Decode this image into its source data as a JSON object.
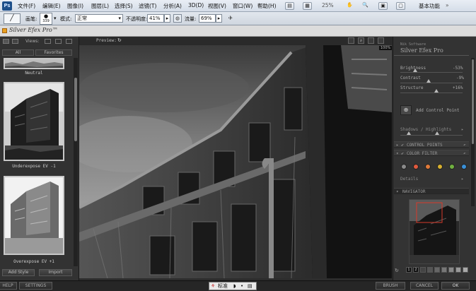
{
  "menubar": {
    "logo": "Ps",
    "items": [
      "文件(F)",
      "编辑(E)",
      "图像(I)",
      "图层(L)",
      "选择(S)",
      "滤镜(T)",
      "分析(A)",
      "3D(D)",
      "视图(V)",
      "窗口(W)",
      "帮助(H)"
    ],
    "zoom": "25%",
    "workspace": "基本功能"
  },
  "optionsbar": {
    "brush_label": "画笔:",
    "brush_size": "339",
    "mode_label": "模式:",
    "mode_value": "正常",
    "opacity_label": "不透明度:",
    "opacity_value": "41%",
    "flow_label": "流量:",
    "flow_value": "69%"
  },
  "plugin": {
    "title": "Silver Efex Pro™",
    "views_label": "Views:",
    "preview_label": "Preview:",
    "zoom": "100%"
  },
  "leftpanel": {
    "tabs": [
      "All",
      "Favorites"
    ],
    "presets": [
      "Neutral",
      "Underexpose EV -1",
      "Overexpose EV +1"
    ],
    "add_style": "Add Style",
    "import": "Import"
  },
  "rightpanel": {
    "brand": "Nik Software",
    "product": "Silver Efex Pro",
    "sliders": [
      {
        "label": "Brightness",
        "value": "-53%",
        "level": -0.53
      },
      {
        "label": "Contrast",
        "value": "-9%",
        "level": -0.09
      },
      {
        "label": "Structure",
        "value": "+16%",
        "level": 0.16
      }
    ],
    "add_control_point": "Add Control Point",
    "shadows_highlights": "Shadows / Highlights",
    "sections": [
      "CONTROL POINTS",
      "COLOR FILTER"
    ],
    "details": "Details",
    "navigator": "NAVIGATOR",
    "filter_colors": [
      "#8a8a8a",
      "#e05a3e",
      "#e07a3a",
      "#d8b030",
      "#70b040",
      "#3a90d8"
    ]
  },
  "bottombar": {
    "help": "HELP",
    "settings": "SETTINGS",
    "brush": "BRUSH",
    "cancel": "CANCEL",
    "ok": "OK",
    "ime_text": "标准"
  }
}
